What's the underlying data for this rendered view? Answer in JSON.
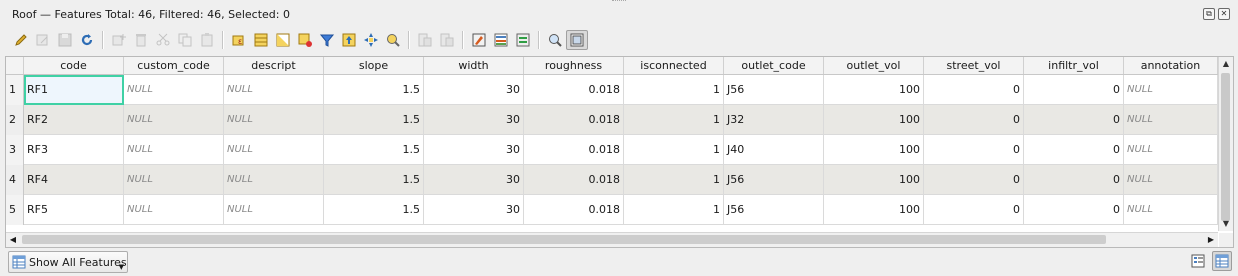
{
  "window": {
    "title": "Roof — Features Total: 46, Filtered: 46, Selected: 0",
    "restore_glyph": "⧉",
    "close_glyph": "✕"
  },
  "toolbar": {
    "buttons": [
      {
        "icon": "pencil-icon",
        "enabled": true
      },
      {
        "icon": "multi-edit-icon",
        "enabled": false
      },
      {
        "icon": "save-edits-icon",
        "enabled": false
      },
      {
        "icon": "reload-icon",
        "enabled": true
      },
      {
        "icon": "add-feature-icon",
        "enabled": false
      },
      {
        "icon": "delete-feature-icon",
        "enabled": false
      },
      {
        "icon": "cut-icon",
        "enabled": false
      },
      {
        "icon": "copy-icon",
        "enabled": false
      },
      {
        "icon": "paste-icon",
        "enabled": false
      },
      {
        "icon": "select-expression-icon",
        "enabled": true
      },
      {
        "icon": "select-all-icon",
        "enabled": true
      },
      {
        "icon": "invert-selection-icon",
        "enabled": true
      },
      {
        "icon": "deselect-all-icon",
        "enabled": true
      },
      {
        "icon": "filter-icon",
        "enabled": true
      },
      {
        "icon": "move-selection-top-icon",
        "enabled": true
      },
      {
        "icon": "pan-to-selection-icon",
        "enabled": true
      },
      {
        "icon": "zoom-to-selection-icon",
        "enabled": true
      },
      {
        "icon": "new-field-icon",
        "enabled": false
      },
      {
        "icon": "delete-field-icon",
        "enabled": false
      },
      {
        "icon": "field-calculator-icon",
        "enabled": true
      },
      {
        "icon": "conditional-formatting-icon",
        "enabled": true
      },
      {
        "icon": "actions-icon",
        "enabled": true
      },
      {
        "icon": "dock-icon",
        "enabled": true
      },
      {
        "icon": "form-view-icon",
        "enabled": true,
        "active": true
      }
    ]
  },
  "table": {
    "columns": [
      {
        "key": "code",
        "label": "code"
      },
      {
        "key": "custom_code",
        "label": "custom_code"
      },
      {
        "key": "descript",
        "label": "descript"
      },
      {
        "key": "slope",
        "label": "slope"
      },
      {
        "key": "width",
        "label": "width"
      },
      {
        "key": "roughness",
        "label": "roughness"
      },
      {
        "key": "isconnected",
        "label": "isconnected"
      },
      {
        "key": "outlet_code",
        "label": "outlet_code"
      },
      {
        "key": "outlet_vol",
        "label": "outlet_vol"
      },
      {
        "key": "street_vol",
        "label": "street_vol"
      },
      {
        "key": "infiltr_vol",
        "label": "infiltr_vol"
      },
      {
        "key": "annotation",
        "label": "annotation"
      }
    ],
    "numeric_columns": [
      "slope",
      "width",
      "roughness",
      "isconnected",
      "outlet_vol",
      "street_vol",
      "infiltr_vol"
    ],
    "null_text": "NULL",
    "rows": [
      {
        "row_num": "1",
        "code": "RF1",
        "custom_code": "NULL",
        "descript": "NULL",
        "slope": "1.5",
        "width": "30",
        "roughness": "0.018",
        "isconnected": "1",
        "outlet_code": "J56",
        "outlet_vol": "100",
        "street_vol": "0",
        "infiltr_vol": "0",
        "annotation": "NULL"
      },
      {
        "row_num": "2",
        "code": "RF2",
        "custom_code": "NULL",
        "descript": "NULL",
        "slope": "1.5",
        "width": "30",
        "roughness": "0.018",
        "isconnected": "1",
        "outlet_code": "J32",
        "outlet_vol": "100",
        "street_vol": "0",
        "infiltr_vol": "0",
        "annotation": "NULL"
      },
      {
        "row_num": "3",
        "code": "RF3",
        "custom_code": "NULL",
        "descript": "NULL",
        "slope": "1.5",
        "width": "30",
        "roughness": "0.018",
        "isconnected": "1",
        "outlet_code": "J40",
        "outlet_vol": "100",
        "street_vol": "0",
        "infiltr_vol": "0",
        "annotation": "NULL"
      },
      {
        "row_num": "4",
        "code": "RF4",
        "custom_code": "NULL",
        "descript": "NULL",
        "slope": "1.5",
        "width": "30",
        "roughness": "0.018",
        "isconnected": "1",
        "outlet_code": "J56",
        "outlet_vol": "100",
        "street_vol": "0",
        "infiltr_vol": "0",
        "annotation": "NULL"
      },
      {
        "row_num": "5",
        "code": "RF5",
        "custom_code": "NULL",
        "descript": "NULL",
        "slope": "1.5",
        "width": "30",
        "roughness": "0.018",
        "isconnected": "1",
        "outlet_code": "J56",
        "outlet_vol": "100",
        "street_vol": "0",
        "infiltr_vol": "0",
        "annotation": "NULL"
      }
    ]
  },
  "footer": {
    "show_all_label": "Show All Features",
    "show_all_icon": "table-icon",
    "view_buttons": [
      {
        "icon": "form-view-icon",
        "active": false
      },
      {
        "icon": "table-view-icon",
        "active": true
      }
    ]
  },
  "colors": {
    "selected_outline": "#3fd1a5",
    "alt_row": "#e9e8e4",
    "null_text": "#8a8a8a"
  }
}
